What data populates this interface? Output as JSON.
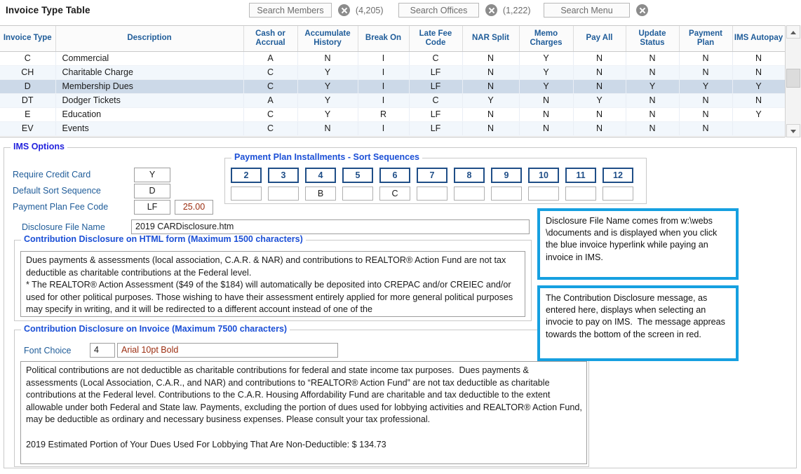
{
  "header": {
    "title": "Invoice Type Table",
    "searches": [
      {
        "label": "Search Members",
        "count": "(4,205)",
        "clear_icon": "clear-circle-icon"
      },
      {
        "label": "Search Offices",
        "count": "(1,222)",
        "clear_icon": "clear-circle-icon"
      },
      {
        "label": "Search Menu",
        "count": "",
        "clear_icon": "clear-circle-icon"
      }
    ]
  },
  "grid": {
    "columns": [
      "Invoice Type",
      "Description",
      "Cash or Accrual",
      "Accumulate History",
      "Break On",
      "Late Fee Code",
      "NAR Split",
      "Memo Charges",
      "Pay All",
      "Update Status",
      "Payment Plan",
      "IMS Autopay"
    ],
    "rows": [
      {
        "type": "C",
        "description": "Commercial",
        "cash_or_accrual": "A",
        "accumulate_history": "N",
        "break_on": "I",
        "late_fee_code": "C",
        "nar_split": "N",
        "memo_charges": "Y",
        "pay_all": "N",
        "update_status": "N",
        "payment_plan": "N",
        "ims_autopay": "N"
      },
      {
        "type": "CH",
        "description": "Charitable Charge",
        "cash_or_accrual": "C",
        "accumulate_history": "Y",
        "break_on": "I",
        "late_fee_code": "LF",
        "nar_split": "N",
        "memo_charges": "Y",
        "pay_all": "N",
        "update_status": "N",
        "payment_plan": "N",
        "ims_autopay": "N"
      },
      {
        "type": "D",
        "description": "Membership Dues",
        "cash_or_accrual": "C",
        "accumulate_history": "Y",
        "break_on": "I",
        "late_fee_code": "LF",
        "nar_split": "N",
        "memo_charges": "Y",
        "pay_all": "N",
        "update_status": "Y",
        "payment_plan": "Y",
        "ims_autopay": "Y"
      },
      {
        "type": "DT",
        "description": "Dodger Tickets",
        "cash_or_accrual": "A",
        "accumulate_history": "Y",
        "break_on": "I",
        "late_fee_code": "C",
        "nar_split": "Y",
        "memo_charges": "N",
        "pay_all": "Y",
        "update_status": "N",
        "payment_plan": "N",
        "ims_autopay": "N"
      },
      {
        "type": "E",
        "description": "Education",
        "cash_or_accrual": "C",
        "accumulate_history": "Y",
        "break_on": "R",
        "late_fee_code": "LF",
        "nar_split": "N",
        "memo_charges": "N",
        "pay_all": "N",
        "update_status": "N",
        "payment_plan": "N",
        "ims_autopay": "Y"
      },
      {
        "type": "EV",
        "description": "Events",
        "cash_or_accrual": "C",
        "accumulate_history": "N",
        "break_on": "I",
        "late_fee_code": "LF",
        "nar_split": "N",
        "memo_charges": "N",
        "pay_all": "N",
        "update_status": "N",
        "payment_plan": "N",
        "ims_autopay": ""
      }
    ],
    "selected_row_index": 2,
    "scrollbar": {
      "up_icon": "chevron-up-icon",
      "down_icon": "chevron-down-icon"
    }
  },
  "ims_options": {
    "legend": "IMS Options",
    "require_credit_card": {
      "label": "Require Credit Card",
      "value": "Y"
    },
    "default_sort_sequence": {
      "label": "Default Sort Sequence",
      "value": "D"
    },
    "payment_plan_fee_code": {
      "label": "Payment Plan Fee Code",
      "value": "LF",
      "amount": "25.00"
    },
    "disclosure_file_name": {
      "label": "Disclosure File Name",
      "value": "2019 CARDisclosure.htm"
    }
  },
  "installments": {
    "legend": "Payment Plan Installments - Sort Sequences",
    "numbers": [
      "2",
      "3",
      "4",
      "5",
      "6",
      "7",
      "8",
      "9",
      "10",
      "11",
      "12"
    ],
    "values": [
      "",
      "",
      "B",
      "",
      "C",
      "",
      "",
      "",
      "",
      "",
      ""
    ]
  },
  "html_disclosure": {
    "legend": "Contribution Disclosure on HTML form (Maximum 1500 characters)",
    "text": "Dues payments & assessments (local association, C.A.R. & NAR) and contributions to REALTOR® Action Fund are not tax deductible as charitable contributions at the Federal level.\n* The REALTOR® Action Assessment ($49 of the $184) will automatically be deposited into CREPAC and/or CREIEC and/or used for other political purposes. Those wishing to have their assessment entirely applied for more general political purposes may specify in writing, and it will be redirected to a different account instead of one of the"
  },
  "invoice_disclosure": {
    "legend": "Contribution Disclosure on Invoice (Maximum 7500 characters)",
    "font_choice": {
      "label": "Font Choice",
      "value": "4",
      "description": "Arial 10pt Bold"
    },
    "text": "Political contributions are not deductible as charitable contributions for federal and state income tax purposes.  Dues payments & assessments (Local Association, C.A.R., and NAR) and contributions to “REALTOR® Action Fund” are not tax deductible as charitable contributions at the Federal level. Contributions to the C.A.R. Housing Affordability Fund are charitable and tax deductible to the extent allowable under both Federal and State law. Payments, excluding the portion of dues used for lobbying activities and REALTOR® Action Fund, may be deductible as ordinary and necessary business expenses. Please consult your tax professional.\n\n2019 Estimated Portion of Your Dues Used For Lobbying That Are Non-Deductible: $ 134.73"
  },
  "callouts": [
    {
      "text": "Disclosure File Name comes from w:\\webs \\documents and is displayed when you click the blue invoice hyperlink while paying an invoice in IMS."
    },
    {
      "text": "The Contribution Disclosure message, as entered here, displays when selecting an invocie to pay on IMS.  The message appreas towards the bottom of the screen in red."
    }
  ],
  "colors": {
    "legend_blue": "#2222dd",
    "header_blue": "#1f5c99",
    "callout_border": "#16a0e0",
    "selected_row": "#ccd9e8",
    "alt_row": "#f2f7fc"
  }
}
